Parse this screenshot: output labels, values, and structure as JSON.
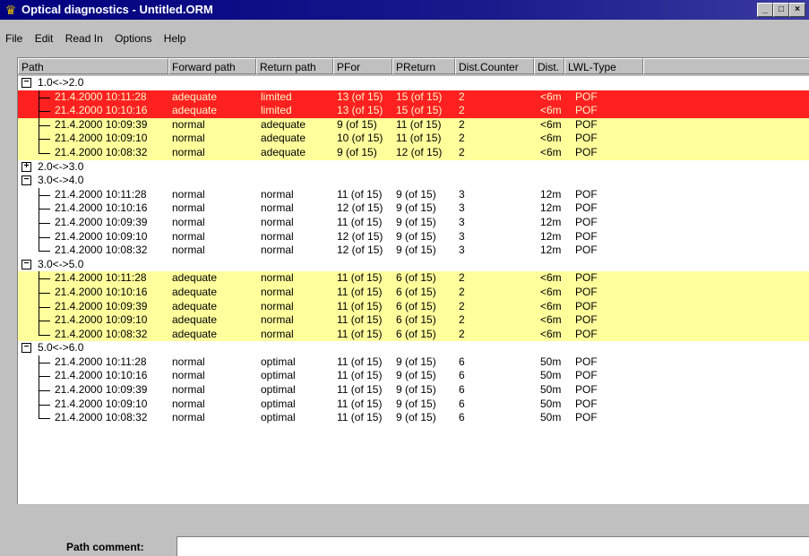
{
  "window": {
    "title": "Optical diagnostics - Untitled.ORM",
    "app_icon": "crown-icon",
    "buttons": [
      "minimize",
      "maximize",
      "close"
    ]
  },
  "menu": [
    "File",
    "Edit",
    "Read In",
    "Options",
    "Help"
  ],
  "columns": [
    "Path",
    "Forward path",
    "Return path",
    "PFor",
    "PReturn",
    "Dist.Counter",
    "Dist.",
    "LWL-Type"
  ],
  "groups": [
    {
      "label": "1.0<->2.0",
      "toggle": "−",
      "rows": [
        {
          "time": "21.4.2000 10:11:28",
          "forward": "adequate",
          "return": "limited",
          "pfor": "13 (of 15)",
          "preturn": "15 (of 15)",
          "counter": "2",
          "dist": "<6m",
          "type": "POF",
          "color": "red"
        },
        {
          "time": "21.4.2000 10:10:16",
          "forward": "adequate",
          "return": "limited",
          "pfor": "13 (of 15)",
          "preturn": "15 (of 15)",
          "counter": "2",
          "dist": "<6m",
          "type": "POF",
          "color": "red"
        },
        {
          "time": "21.4.2000 10:09:39",
          "forward": "normal",
          "return": "adequate",
          "pfor": "9 (of 15)",
          "preturn": "11 (of 15)",
          "counter": "2",
          "dist": "<6m",
          "type": "POF",
          "color": "yellow"
        },
        {
          "time": "21.4.2000 10:09:10",
          "forward": "normal",
          "return": "adequate",
          "pfor": "10 (of 15)",
          "preturn": "11 (of 15)",
          "counter": "2",
          "dist": "<6m",
          "type": "POF",
          "color": "yellow"
        },
        {
          "time": "21.4.2000 10:08:32",
          "forward": "normal",
          "return": "adequate",
          "pfor": "9 (of 15)",
          "preturn": "12 (of 15)",
          "counter": "2",
          "dist": "<6m",
          "type": "POF",
          "color": "yellow"
        }
      ]
    },
    {
      "label": "2.0<->3.0",
      "toggle": "+",
      "rows": []
    },
    {
      "label": "3.0<->4.0",
      "toggle": "−",
      "rows": [
        {
          "time": "21.4.2000 10:11:28",
          "forward": "normal",
          "return": "normal",
          "pfor": "11 (of 15)",
          "preturn": "9 (of 15)",
          "counter": "3",
          "dist": "12m",
          "type": "POF",
          "color": "white"
        },
        {
          "time": "21.4.2000 10:10:16",
          "forward": "normal",
          "return": "normal",
          "pfor": "12 (of 15)",
          "preturn": "9 (of 15)",
          "counter": "3",
          "dist": "12m",
          "type": "POF",
          "color": "white"
        },
        {
          "time": "21.4.2000 10:09:39",
          "forward": "normal",
          "return": "normal",
          "pfor": "11 (of 15)",
          "preturn": "9 (of 15)",
          "counter": "3",
          "dist": "12m",
          "type": "POF",
          "color": "white"
        },
        {
          "time": "21.4.2000 10:09:10",
          "forward": "normal",
          "return": "normal",
          "pfor": "12 (of 15)",
          "preturn": "9 (of 15)",
          "counter": "3",
          "dist": "12m",
          "type": "POF",
          "color": "white"
        },
        {
          "time": "21.4.2000 10:08:32",
          "forward": "normal",
          "return": "normal",
          "pfor": "12 (of 15)",
          "preturn": "9 (of 15)",
          "counter": "3",
          "dist": "12m",
          "type": "POF",
          "color": "white"
        }
      ]
    },
    {
      "label": "3.0<->5.0",
      "toggle": "−",
      "rows": [
        {
          "time": "21.4.2000 10:11:28",
          "forward": "adequate",
          "return": "normal",
          "pfor": "11 (of 15)",
          "preturn": "6 (of 15)",
          "counter": "2",
          "dist": "<6m",
          "type": "POF",
          "color": "yellow"
        },
        {
          "time": "21.4.2000 10:10:16",
          "forward": "adequate",
          "return": "normal",
          "pfor": "11 (of 15)",
          "preturn": "6 (of 15)",
          "counter": "2",
          "dist": "<6m",
          "type": "POF",
          "color": "yellow"
        },
        {
          "time": "21.4.2000 10:09:39",
          "forward": "adequate",
          "return": "normal",
          "pfor": "11 (of 15)",
          "preturn": "6 (of 15)",
          "counter": "2",
          "dist": "<6m",
          "type": "POF",
          "color": "yellow"
        },
        {
          "time": "21.4.2000 10:09:10",
          "forward": "adequate",
          "return": "normal",
          "pfor": "11 (of 15)",
          "preturn": "6 (of 15)",
          "counter": "2",
          "dist": "<6m",
          "type": "POF",
          "color": "yellow"
        },
        {
          "time": "21.4.2000 10:08:32",
          "forward": "adequate",
          "return": "normal",
          "pfor": "11 (of 15)",
          "preturn": "6 (of 15)",
          "counter": "2",
          "dist": "<6m",
          "type": "POF",
          "color": "yellow"
        }
      ]
    },
    {
      "label": "5.0<->6.0",
      "toggle": "−",
      "rows": [
        {
          "time": "21.4.2000 10:11:28",
          "forward": "normal",
          "return": "optimal",
          "pfor": "11 (of 15)",
          "preturn": "9 (of 15)",
          "counter": "6",
          "dist": "50m",
          "type": "POF",
          "color": "white"
        },
        {
          "time": "21.4.2000 10:10:16",
          "forward": "normal",
          "return": "optimal",
          "pfor": "11 (of 15)",
          "preturn": "9 (of 15)",
          "counter": "6",
          "dist": "50m",
          "type": "POF",
          "color": "white"
        },
        {
          "time": "21.4.2000 10:09:39",
          "forward": "normal",
          "return": "optimal",
          "pfor": "11 (of 15)",
          "preturn": "9 (of 15)",
          "counter": "6",
          "dist": "50m",
          "type": "POF",
          "color": "white"
        },
        {
          "time": "21.4.2000 10:09:10",
          "forward": "normal",
          "return": "optimal",
          "pfor": "11 (of 15)",
          "preturn": "9 (of 15)",
          "counter": "6",
          "dist": "50m",
          "type": "POF",
          "color": "white"
        },
        {
          "time": "21.4.2000 10:08:32",
          "forward": "normal",
          "return": "optimal",
          "pfor": "11 (of 15)",
          "preturn": "9 (of 15)",
          "counter": "6",
          "dist": "50m",
          "type": "POF",
          "color": "white"
        }
      ]
    }
  ],
  "comment": {
    "label": "Path comment:",
    "value": ""
  },
  "colors": {
    "red": "#ff2020",
    "yellow": "#ffff99",
    "titlebar": "#000080",
    "window": "#c0c0c0"
  }
}
